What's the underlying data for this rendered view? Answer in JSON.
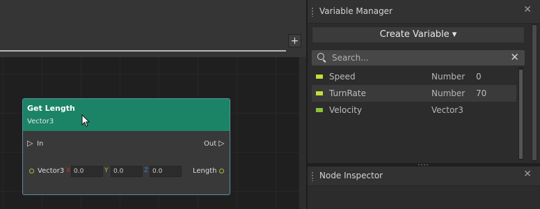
{
  "graph": {
    "add_label": "+",
    "node": {
      "title": "Get Length",
      "subtitle": "Vector3",
      "in_label": "In",
      "out_label": "Out",
      "input_label": "Vector3",
      "x_label": "X",
      "y_label": "Y",
      "z_label": "Z",
      "x_value": "0.0",
      "y_value": "0.0",
      "z_value": "0.0",
      "output_label": "Length",
      "header_color": "#1b8466"
    }
  },
  "variable_manager": {
    "title": "Variable Manager",
    "create_button": "Create Variable ▾",
    "search_placeholder": "Search...",
    "variables": [
      {
        "name": "Speed",
        "type": "Number",
        "value": "0",
        "color": "#c8dc3a"
      },
      {
        "name": "TurnRate",
        "type": "Number",
        "value": "70",
        "color": "#c8dc3a"
      },
      {
        "name": "Velocity",
        "type": "Vector3",
        "value": "",
        "color": "#8cc23a"
      }
    ]
  },
  "node_inspector": {
    "title": "Node Inspector"
  },
  "icons": {
    "close": "close-icon",
    "search": "search-icon",
    "grip": "grip-icon"
  }
}
